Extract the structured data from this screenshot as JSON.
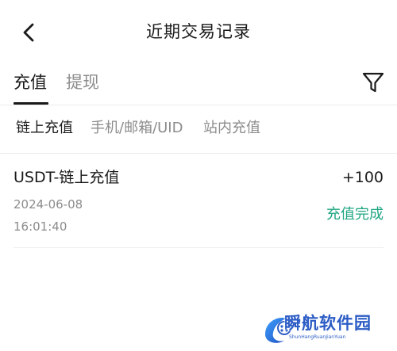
{
  "header": {
    "back_icon": "chevron-left-icon",
    "title": "近期交易记录"
  },
  "main_tabs": {
    "items": [
      {
        "label": "充值",
        "active": true
      },
      {
        "label": "提现",
        "active": false
      }
    ],
    "filter_icon": "filter-funnel-icon"
  },
  "sub_tabs": {
    "items": [
      {
        "label": "链上充值",
        "active": true
      },
      {
        "label": "手机/邮箱/UID",
        "active": false
      },
      {
        "label": "站内充值",
        "active": false
      }
    ]
  },
  "records": [
    {
      "title": "USDT-链上充值",
      "amount": "+100",
      "date": "2024-06-08",
      "time": "16:01:40",
      "status": "充值完成"
    }
  ],
  "watermark": {
    "text": "瞬航软件园",
    "subtext": "ShunHangRuanJianYuan"
  },
  "colors": {
    "primary_text": "#1a1a1a",
    "secondary_text": "#8c8c8c",
    "success": "#20a582",
    "divider": "#ececec",
    "watermark": "#2c5cc5"
  }
}
